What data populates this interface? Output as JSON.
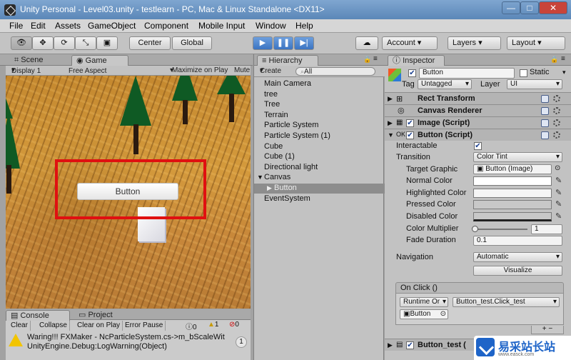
{
  "window": {
    "title": "Unity Personal - Level03.unity - testlearn - PC, Mac & Linux Standalone <DX11>",
    "minimize": "—",
    "maximize": "□",
    "close": "✕"
  },
  "menu": [
    "File",
    "Edit",
    "Assets",
    "GameObject",
    "Component",
    "Mobile Input",
    "Window",
    "Help"
  ],
  "toolbar": {
    "tools": [
      "eye-icon",
      "move-icon",
      "rotate-icon",
      "scale-icon",
      "rect-icon"
    ],
    "pivot": "Center",
    "space": "Global",
    "cloud": "cloud-icon",
    "account": "Account",
    "layers": "Layers",
    "layout": "Layout"
  },
  "game_panel": {
    "tabs": [
      "Scene",
      "Game"
    ],
    "display": "Display 1",
    "aspect": "Free Aspect",
    "maximize_on_play": "Maximize on Play",
    "mute": "Mute",
    "ui_button_text": "Button"
  },
  "console": {
    "tabs": [
      "Console",
      "Project"
    ],
    "buttons": [
      "Clear",
      "Collapse",
      "Clear on Play",
      "Error Pause"
    ],
    "counts": {
      "info": "0",
      "warn": "1",
      "error": "0"
    },
    "log_line1": "Waring!!! FXMaker - NcParticleSystem.cs->m_bScaleWit",
    "log_line2": "UnityEngine.Debug:LogWarning(Object)",
    "badge": "1"
  },
  "hierarchy": {
    "title": "Hierarchy",
    "create": "Create",
    "search_placeholder": "All",
    "items": [
      "Main Camera",
      "tree",
      "Tree",
      "Terrain",
      "Particle System",
      "Particle System (1)",
      "Cube",
      "Cube (1)",
      "Directional light",
      "Canvas",
      "Button",
      "EventSystem"
    ]
  },
  "inspector": {
    "title": "Inspector",
    "object_name": "Button",
    "static_label": "Static",
    "tag_label": "Tag",
    "tag_value": "Untagged",
    "layer_label": "Layer",
    "layer_value": "UI",
    "components": [
      "Rect Transform",
      "Canvas Renderer",
      "Image (Script)",
      "Button (Script)"
    ],
    "interactable_label": "Interactable",
    "transition_label": "Transition",
    "transition_value": "Color Tint",
    "target_graphic_label": "Target Graphic",
    "target_graphic_value": "Button (Image)",
    "normal_color_label": "Normal Color",
    "highlighted_color_label": "Highlighted Color",
    "pressed_color_label": "Pressed Color",
    "disabled_color_label": "Disabled Color",
    "color_multiplier_label": "Color Multiplier",
    "color_multiplier_value": "1",
    "fade_duration_label": "Fade Duration",
    "fade_duration_value": "0.1",
    "navigation_label": "Navigation",
    "navigation_value": "Automatic",
    "visualize_label": "Visualize",
    "onclick_label": "On Click ()",
    "runtime_value": "Runtime Or",
    "function_value": "Button_test.Click_test",
    "object_ref": "Button",
    "add_remove": "+ −",
    "extra_component": "Button_test (",
    "slider_fraction": 0
  },
  "watermark": {
    "text": "易采站长站",
    "url": "www.easck.com"
  },
  "colors": {
    "accent": "#3b74c2",
    "highlight": "#e01010",
    "hier_selected": "#8d8d8d"
  }
}
